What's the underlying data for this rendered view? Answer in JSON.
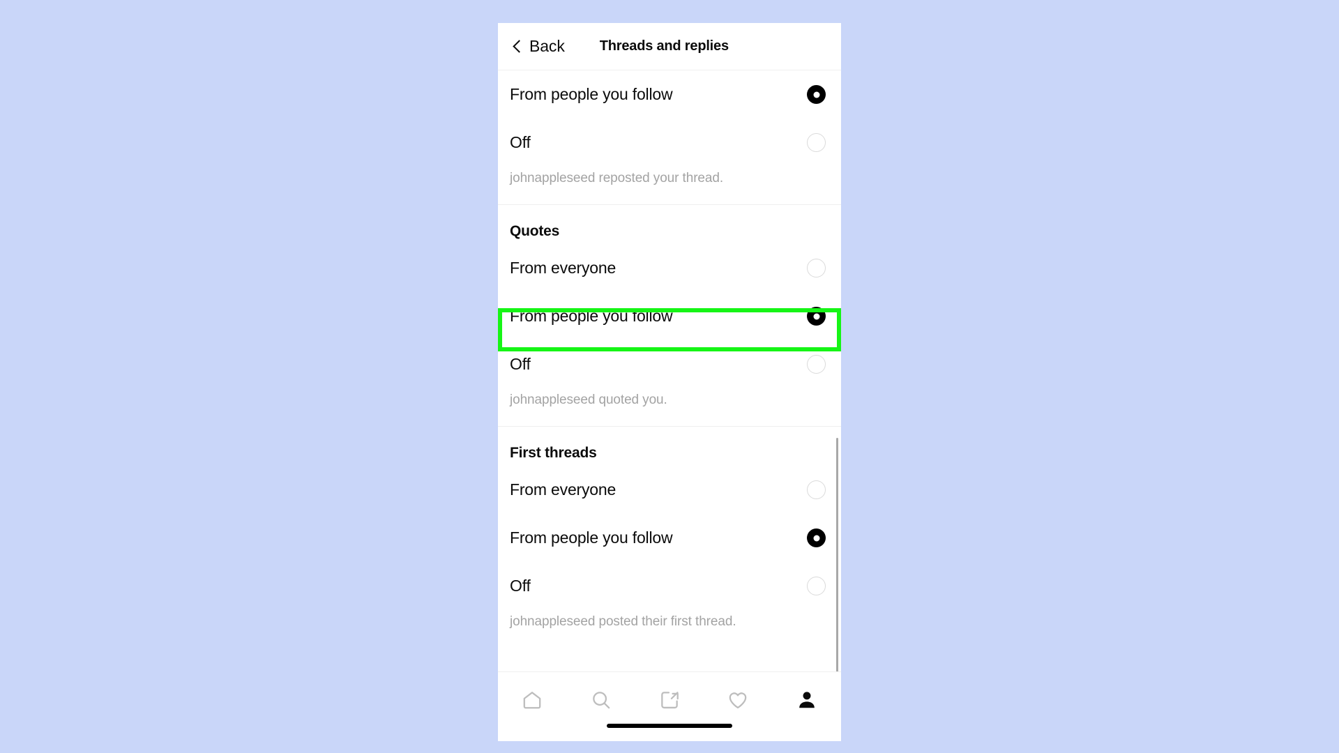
{
  "background_color": "#c9d6f9",
  "highlight_color": "#16f516",
  "header": {
    "back_label": "Back",
    "title": "Threads and replies",
    "back_icon": "chevron-left-icon"
  },
  "sections": [
    {
      "id": "reposts",
      "title": null,
      "options": [
        {
          "label": "From people you follow",
          "selected": true
        },
        {
          "label": "Off",
          "selected": false
        }
      ],
      "hint": "johnappleseed reposted your thread."
    },
    {
      "id": "quotes",
      "title": "Quotes",
      "options": [
        {
          "label": "From everyone",
          "selected": false
        },
        {
          "label": "From people you follow",
          "selected": true,
          "highlighted": true
        },
        {
          "label": "Off",
          "selected": false
        }
      ],
      "hint": "johnappleseed quoted you."
    },
    {
      "id": "first-threads",
      "title": "First threads",
      "options": [
        {
          "label": "From everyone",
          "selected": false
        },
        {
          "label": "From people you follow",
          "selected": true
        },
        {
          "label": "Off",
          "selected": false
        }
      ],
      "hint": "johnappleseed posted their first thread."
    }
  ],
  "bottom_nav": [
    {
      "icon": "home-icon",
      "label": "Home",
      "active": false
    },
    {
      "icon": "search-icon",
      "label": "Search",
      "active": false
    },
    {
      "icon": "compose-icon",
      "label": "Compose",
      "active": false
    },
    {
      "icon": "heart-icon",
      "label": "Activity",
      "active": false
    },
    {
      "icon": "profile-icon",
      "label": "Profile",
      "active": true
    }
  ]
}
